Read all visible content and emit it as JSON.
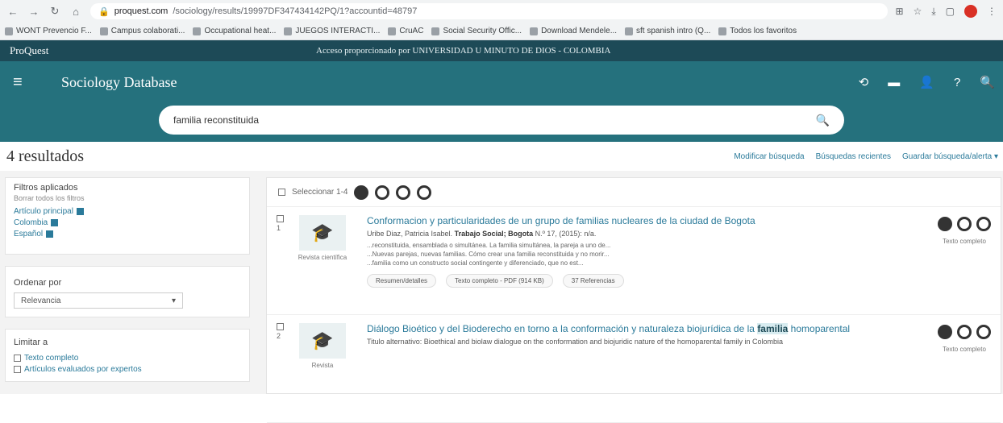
{
  "browser": {
    "url_host": "proquest.com",
    "url_path": "/sociology/results/19997DF347434142PQ/1?accountid=48797",
    "bookmarks": [
      "WONT Prevencio F...",
      "Campus colaborati...",
      "Occupational heat...",
      "JUEGOS INTERACTI...",
      "CruAC",
      "Social Security Offic...",
      "Download Mendele...",
      "sft spanish intro (Q...",
      "Todos los favoritos"
    ]
  },
  "topbar": {
    "brand": "ProQuest",
    "access": "Acceso proporcionado por UNIVERSIDAD U MINUTO DE DIOS - COLOMBIA"
  },
  "header": {
    "title": "Sociology Database"
  },
  "search": {
    "query": "familia reconstituida"
  },
  "results_header": {
    "count": "4 resultados",
    "links": [
      "Modificar búsqueda",
      "Búsquedas recientes",
      "Guardar búsqueda/alerta ▾"
    ]
  },
  "filters": {
    "title": "Filtros aplicados",
    "clear": "Borrar todos los filtros",
    "items": [
      "Artículo principal",
      "Colombia",
      "Español"
    ]
  },
  "sort": {
    "title": "Ordenar por",
    "value": "Relevancia"
  },
  "limit": {
    "title": "Limitar a",
    "options": [
      "Texto completo",
      "Artículos evaluados por expertos"
    ]
  },
  "select_all": "Seleccionar 1-4",
  "results": [
    {
      "index": "1",
      "type": "Revista científica",
      "title": "Conformacion y particularidades de un grupo de familias nucleares de la ciudad de Bogota",
      "meta_author": "Uribe Diaz, Patricia Isabel.",
      "meta_source": "Trabajo Social; Bogota",
      "meta_rest": "N.º 17, (2015): n/a.",
      "snippets": [
        "...reconstituida, ensamblada o simultánea. La familia simultánea, la pareja a uno de...",
        "...Nuevas parejas, nuevas familias. Cómo crear una familia reconstituida y no morir...",
        "...familia como un constructo social contingente y diferenciado, que no est..."
      ],
      "actions": [
        "Resumen/detalles",
        "Texto completo - PDF (914 KB)",
        "37 Referencias"
      ],
      "full_text": "Texto completo"
    },
    {
      "index": "2",
      "type": "Revista",
      "title_a": "Diálogo Bioético y del Bioderecho en torno a la conformación y naturaleza biojurídica de la",
      "title_hl": "familia",
      "title_b": "homoparental",
      "alt_title": "Titulo alternativo: Bioethical and biolaw dialogue on the conformation and biojuridic nature of the homoparental family in Colombia",
      "full_text": "Texto completo"
    }
  ]
}
